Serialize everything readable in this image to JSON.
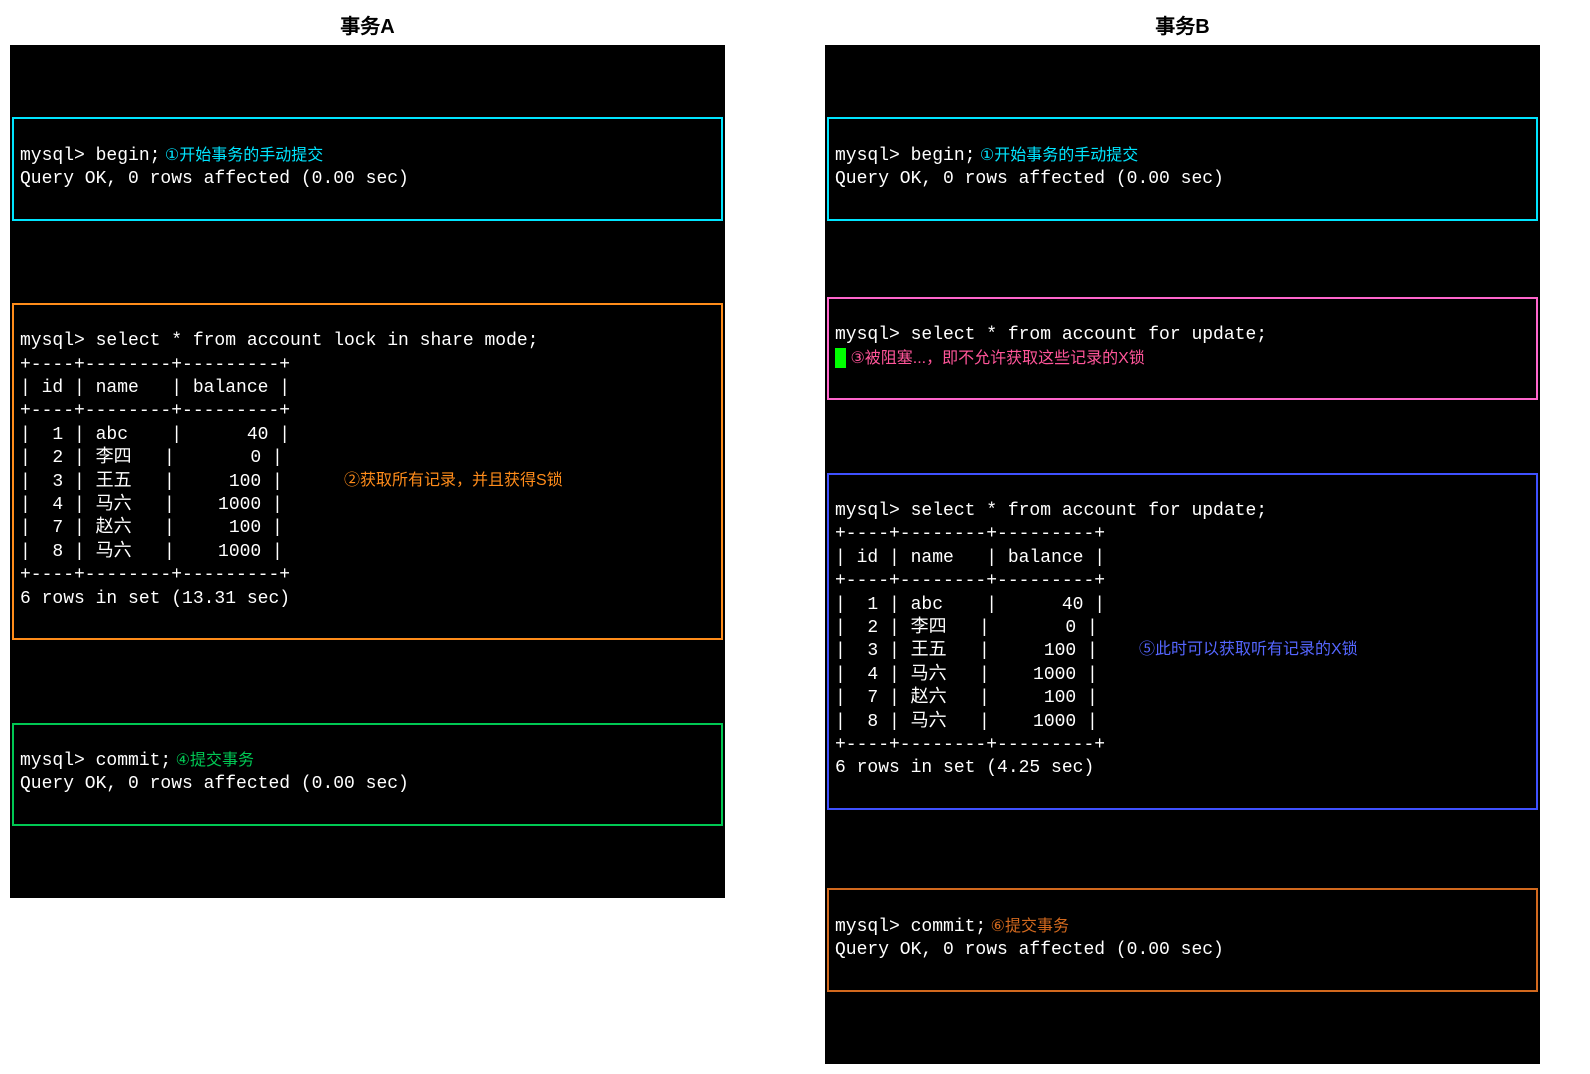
{
  "txnA": {
    "title": "事务A",
    "begin": {
      "prompt": "mysql> begin;",
      "note": " ①开始事务的手动提交",
      "result": "Query OK, 0 rows affected (0.00 sec)"
    },
    "select": {
      "query": "mysql> select * from account lock in share mode;",
      "header_sep": "+----+--------+---------+",
      "header": "| id | name   | balance |",
      "rows": [
        "|  1 | abc    |      40 |",
        "|  2 | 李四   |       0 |",
        "|  3 | 王五   |     100 |",
        "|  4 | 马六   |    1000 |",
        "|  7 | 赵六   |     100 |",
        "|  8 | 马六   |    1000 |"
      ],
      "note": "②获取所有记录，并且获得S锁",
      "footer": "6 rows in set (13.31 sec)"
    },
    "commit": {
      "prompt": "mysql> commit;",
      "note": " ④提交事务",
      "result": "Query OK, 0 rows affected (0.00 sec)"
    }
  },
  "txnB": {
    "title": "事务B",
    "begin": {
      "prompt": "mysql> begin;",
      "note": " ①开始事务的手动提交",
      "result": "Query OK, 0 rows affected (0.00 sec)"
    },
    "blocked": {
      "query": "mysql> select * from account for update;",
      "note": " ③被阻塞...，即不允许获取这些记录的X锁"
    },
    "select": {
      "query": "mysql> select * from account for update;",
      "header_sep": "+----+--------+---------+",
      "header": "| id | name   | balance |",
      "rows": [
        "|  1 | abc    |      40 |",
        "|  2 | 李四   |       0 |",
        "|  3 | 王五   |     100 |",
        "|  4 | 马六   |    1000 |",
        "|  7 | 赵六   |     100 |",
        "|  8 | 马六   |    1000 |"
      ],
      "note": "⑤此时可以获取听有记录的X锁",
      "footer": "6 rows in set (4.25 sec)"
    },
    "commit": {
      "prompt": "mysql> commit;",
      "note": " ⑥提交事务",
      "result": "Query OK, 0 rows affected (0.00 sec)"
    }
  },
  "chart_data": {
    "type": "table",
    "title": "account",
    "columns": [
      "id",
      "name",
      "balance"
    ],
    "rows": [
      [
        1,
        "abc",
        40
      ],
      [
        2,
        "李四",
        0
      ],
      [
        3,
        "王五",
        100
      ],
      [
        4,
        "马六",
        1000
      ],
      [
        7,
        "赵六",
        100
      ],
      [
        8,
        "马六",
        1000
      ]
    ]
  }
}
